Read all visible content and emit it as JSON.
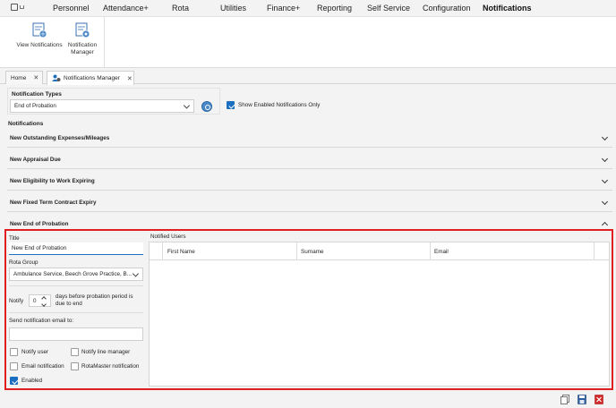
{
  "menu": {
    "items": [
      "Personnel",
      "Attendance+",
      "Rota",
      "Utilities",
      "Finance+",
      "Reporting",
      "Self Service",
      "Configuration",
      "Notifications"
    ],
    "active": "Notifications"
  },
  "ribbon": {
    "view_notifications": "View Notifications",
    "notification_manager_line1": "Notification",
    "notification_manager_line2": "Manager"
  },
  "tabs": {
    "home": "Home",
    "notifications_manager": "Notifications Manager"
  },
  "notification_types": {
    "label": "Notification Types",
    "selected": "End of Probation",
    "show_enabled_only": "Show Enabled Notifications Only"
  },
  "notifications_label": "Notifications",
  "sections": [
    "New Outstanding Expenses/Mileages",
    "New Appraisal Due",
    "New Eligibility to Work Expiring",
    "New Fixed Term Contract Expiry",
    "New End of Probation"
  ],
  "form": {
    "title_label": "Title",
    "title_value": "New End of Probation",
    "rota_group_label": "Rota Group",
    "rota_group_value": "Ambulance Service, Beech Grove Practice, B...",
    "notify_label": "Notify",
    "notify_value": "0",
    "days_text_line1": "days before probation period is",
    "days_text_line2": "due to end",
    "send_email_label": "Send notification email to:",
    "send_email_value": "",
    "notify_user": "Notify user",
    "notify_line_manager": "Notify line manager",
    "email_notification": "Email notification",
    "rotamaster_notification": "RotaMaster notification",
    "enabled": "Enabled"
  },
  "notified_users": {
    "label": "Notified Users",
    "columns": [
      "First Name",
      "Surname",
      "Email"
    ]
  }
}
